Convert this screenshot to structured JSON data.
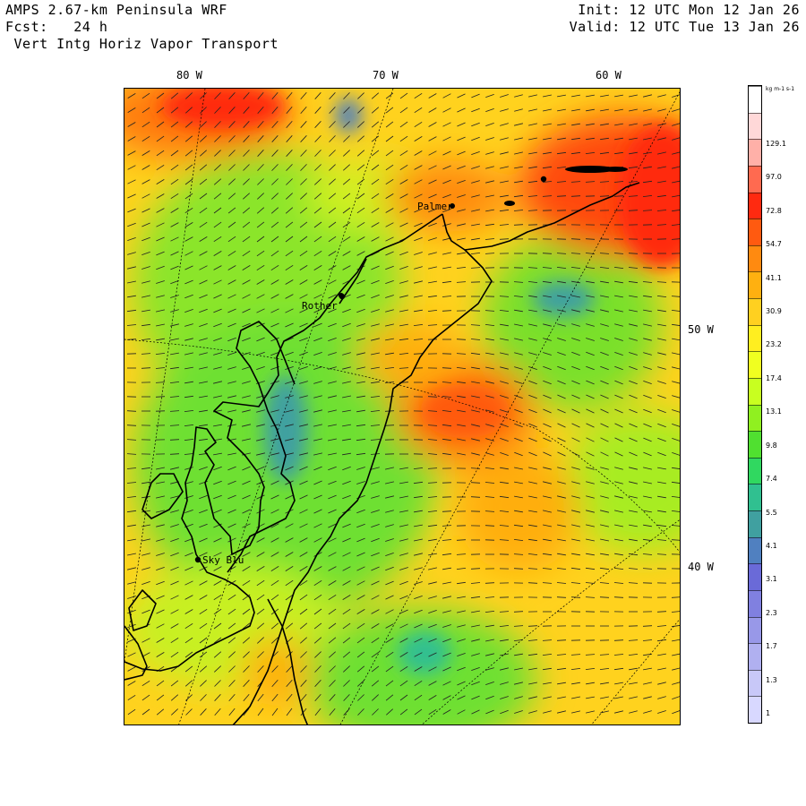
{
  "header": {
    "line1_left": "AMPS 2.67-km Peninsula WRF",
    "line2_left": "Fcst:   24 h",
    "line3_left": " Vert Intg Horiz Vapor Transport",
    "init": "Init: 12 UTC Mon 12 Jan 26",
    "valid": "Valid: 12 UTC Tue 13 Jan 26"
  },
  "map": {
    "longitude_labels": [
      "80 W",
      "70 W",
      "60 W"
    ],
    "latitude_labels": [
      "50 W",
      "40 W"
    ],
    "stations": [
      {
        "name": "Palmer"
      },
      {
        "name": "Rother"
      },
      {
        "name": "Sky Blu"
      }
    ],
    "field": "vertically integrated horizontal vapor transport",
    "colors": {
      "background": "#ffff00",
      "land_outline": "#000000",
      "gridlines": "#000000"
    }
  },
  "colorbar": {
    "units": "kg m-1 s-1",
    "labels": [
      "129.1",
      "97.0",
      "72.8",
      "54.7",
      "41.1",
      "30.9",
      "23.2",
      "17.4",
      "13.1",
      "9.8",
      "7.4",
      "5.5",
      "4.1",
      "3.1",
      "2.3",
      "1.7",
      "1.3",
      "1"
    ],
    "colors": [
      "#ffffff",
      "#ffd8d8",
      "#ffb0a8",
      "#ff6a50",
      "#ff2a10",
      "#ff5a10",
      "#ff8a10",
      "#ffb010",
      "#ffd020",
      "#ffee20",
      "#f0ff20",
      "#c8ff20",
      "#90f020",
      "#50e030",
      "#30d860",
      "#30c090",
      "#40a0a0",
      "#5080c0",
      "#6a6ad8",
      "#8080e0",
      "#9898e8",
      "#b0b0f0",
      "#c8c8f8",
      "#d8d8ff"
    ]
  }
}
